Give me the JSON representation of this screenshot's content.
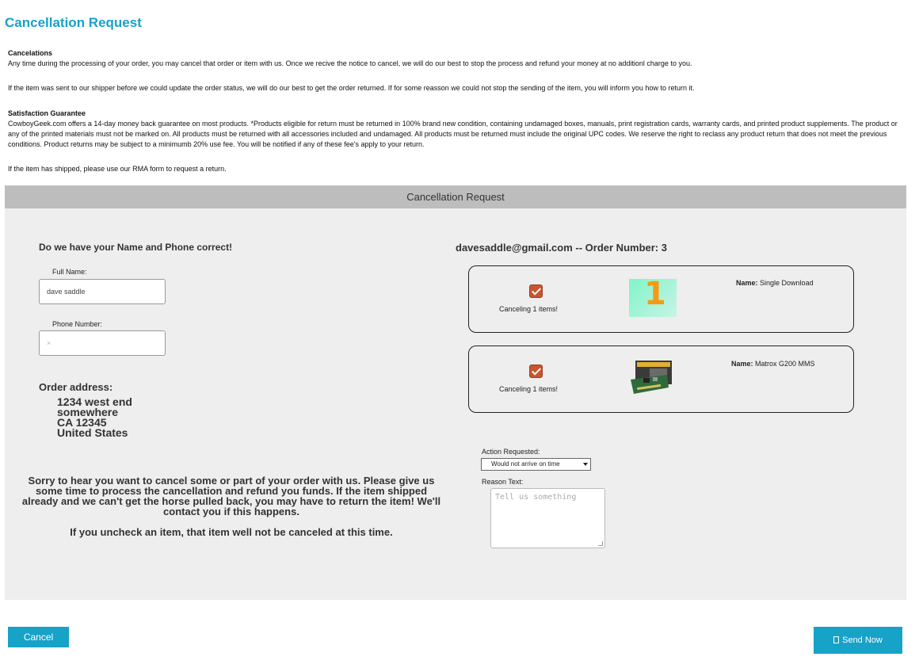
{
  "page": {
    "title": "Cancellation Request"
  },
  "policy": {
    "cancelations_heading": "Cancelations",
    "cancelations_text": "Any time during the processing of your order, you may cancel that order or item with us. Once we recive the notice to cancel, we will do our best to stop the process and refund your money at no additionl charge to you.",
    "shipper_text": "If the item was sent to our shipper before we could update the order status, we will do our best to get the order returned. If for some reasson we could not stop the sending of the item, you will inform you how to return it.",
    "guarantee_heading": "Satisfaction Guarantee",
    "guarantee_text": "CowboyGeek.com offers a 14-day money back guarantee on most products. *Products eligible for return must be returned in 100% brand new condition, containing undamaged boxes, manuals, print registration cards, warranty cards, and printed product supplements. The product or any of the printed materials must not be marked on. All products must be returned with all accessories included and undamaged. All products must be returned must include the original UPC codes. We reserve the right to reclass any product return that does not meet the previous conditions. Product returns may be subject to a minimumb 20% use fee. You will be notified if any of these fee's apply to your return.",
    "shipped_text": "If the item has shipped, please use our RMA form to request a return."
  },
  "form": {
    "header": "Cancellation Request",
    "name_phone_heading": "Do we have your Name and Phone correct!",
    "full_name_label": "Full Name:",
    "full_name_value": "dave saddle",
    "phone_label": "Phone Number:",
    "phone_placeholder": "×",
    "order_address_label": "Order address:",
    "address_lines": [
      "1234 west end",
      "somewhere",
      "CA 12345",
      "United States"
    ],
    "sorry_text": "Sorry to hear you want to cancel some or part of your order with us. Please give us some time to process the cancellation and refund you funds. If the item shipped already and we can't get the horse pulled back, you may have to return the item! We'll contact you if this happens.",
    "uncheck_text": "If you uncheck an item, that item well not be canceled at this time.",
    "email_order_line": "davesaddle@gmail.com -- Order Number: 3",
    "items": [
      {
        "cancel_text": "Canceling 1 items!",
        "name_label": "Name:",
        "name": "Single Download",
        "checked": true
      },
      {
        "cancel_text": "Canceling 1 items!",
        "name_label": "Name:",
        "name": "Matrox G200 MMS",
        "checked": true
      }
    ],
    "action_label": "Action Requested:",
    "action_value": "Would not arrive on time",
    "reason_label": "Reason Text:",
    "reason_placeholder": "Tell us something"
  },
  "buttons": {
    "cancel": "Cancel",
    "send": "Send Now"
  },
  "colors": {
    "accent": "#17a2c8",
    "panel_bg": "#eeeeee",
    "panel_header": "#bdbdbd",
    "checkbox": "#c8562e"
  }
}
